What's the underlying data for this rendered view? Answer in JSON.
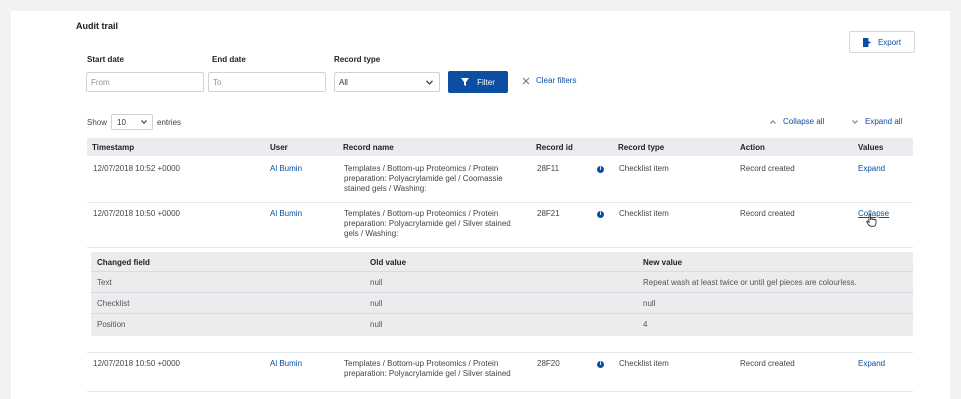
{
  "header": {
    "title": "Audit trail",
    "export_label": "Export"
  },
  "filters": {
    "start_label": "Start date",
    "end_label": "End date",
    "type_label": "Record type",
    "start_placeholder": "From",
    "end_placeholder": "To",
    "type_value": "All",
    "filter_label": "Filter",
    "clear_label": "Clear filters"
  },
  "entries": {
    "show_label": "Show",
    "count": "10",
    "entries_label": "entries"
  },
  "controls": {
    "collapse_all": "Collapse all",
    "expand_all": "Expand all"
  },
  "columns": [
    "Timestamp",
    "User",
    "Record name",
    "Record id",
    "Record type",
    "Action",
    "Values"
  ],
  "rows": [
    {
      "timestamp": "12/07/2018 10:52 +0000",
      "user": "Al Bumin",
      "name_lines": [
        "Templates / Bottom-up Proteomics / Protein",
        "preparation: Polyacrylamide gel / Coomassie",
        "stained gels / Washing:"
      ],
      "record_id": "28F11",
      "record_type": "Checklist item",
      "action": "Record created",
      "values": "Expand"
    },
    {
      "timestamp": "12/07/2018 10:50 +0000",
      "user": "Al Bumin",
      "name_lines": [
        "Templates / Bottom-up Proteomics / Protein",
        "preparation: Polyacrylamide gel / Silver stained",
        "gels / Washing:"
      ],
      "record_id": "28F21",
      "record_type": "Checklist item",
      "action": "Record created",
      "values": "Collapse"
    },
    {
      "timestamp": "12/07/2018 10:50 +0000",
      "user": "Al Bumin",
      "name_lines": [
        "Templates / Bottom-up Proteomics / Protein",
        "preparation: Polyacrylamide gel / Silver stained"
      ],
      "record_id": "28F20",
      "record_type": "Checklist item",
      "action": "Record created",
      "values": "Expand"
    }
  ],
  "changes": {
    "columns": [
      "Changed field",
      "Old value",
      "New value"
    ],
    "rows": [
      {
        "field": "Text",
        "old": "null",
        "new": "Repeat wash at least twice or until gel pieces are colourless."
      },
      {
        "field": "Checklist",
        "old": "null",
        "new": "null"
      },
      {
        "field": "Position",
        "old": "null",
        "new": "4"
      }
    ]
  },
  "colors": {
    "accent": "#0b4ea2",
    "table_header": "#ebecef",
    "detail_bg": "#ececee"
  },
  "icons": [
    "export-icon",
    "filter-icon",
    "close-icon",
    "chevron-down-icon",
    "chevron-up-icon",
    "info-icon",
    "pointer-cursor-icon"
  ]
}
